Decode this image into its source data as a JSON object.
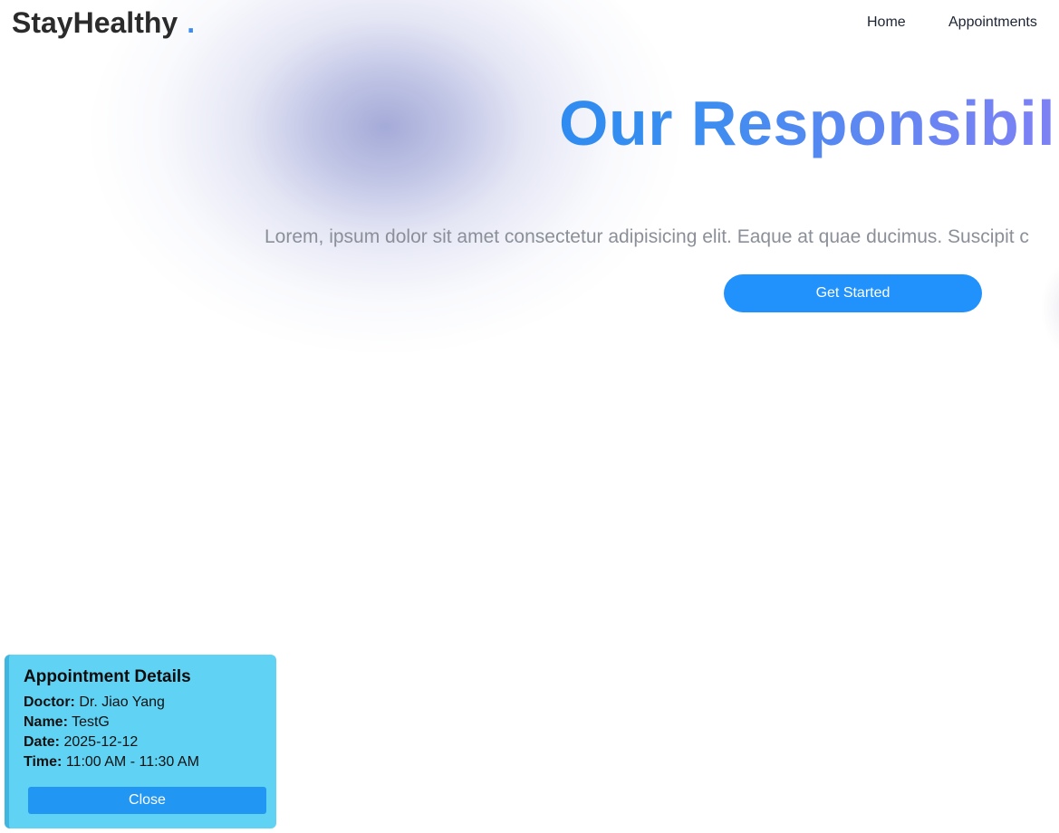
{
  "navbar": {
    "brand": "StayHealthy",
    "brand_dot": ".",
    "links": {
      "home": "Home",
      "appointments": "Appointments"
    }
  },
  "hero": {
    "title": "Our Responsibil",
    "text": "Lorem, ipsum dolor sit amet consectetur adipisicing elit. Eaque at quae ducimus. Suscipit c",
    "cta_label": "Get Started"
  },
  "appointment": {
    "title": "Appointment Details",
    "doctor_label": "Doctor:",
    "doctor": "Dr. Jiao Yang",
    "name_label": "Name:",
    "name": "TestG",
    "date_label": "Date:",
    "date": "2025-12-12",
    "time_label": "Time:",
    "time": "11:00 AM - 11:30 AM",
    "close_label": "Close"
  },
  "colors": {
    "accent": "#2191fb",
    "title_gradient_start": "#2f8cf0",
    "title_gradient_end": "#9b7bf5",
    "card_background": "#60d3f5",
    "close_button": "#2196f3",
    "brand_dot": "#3d8bef"
  }
}
